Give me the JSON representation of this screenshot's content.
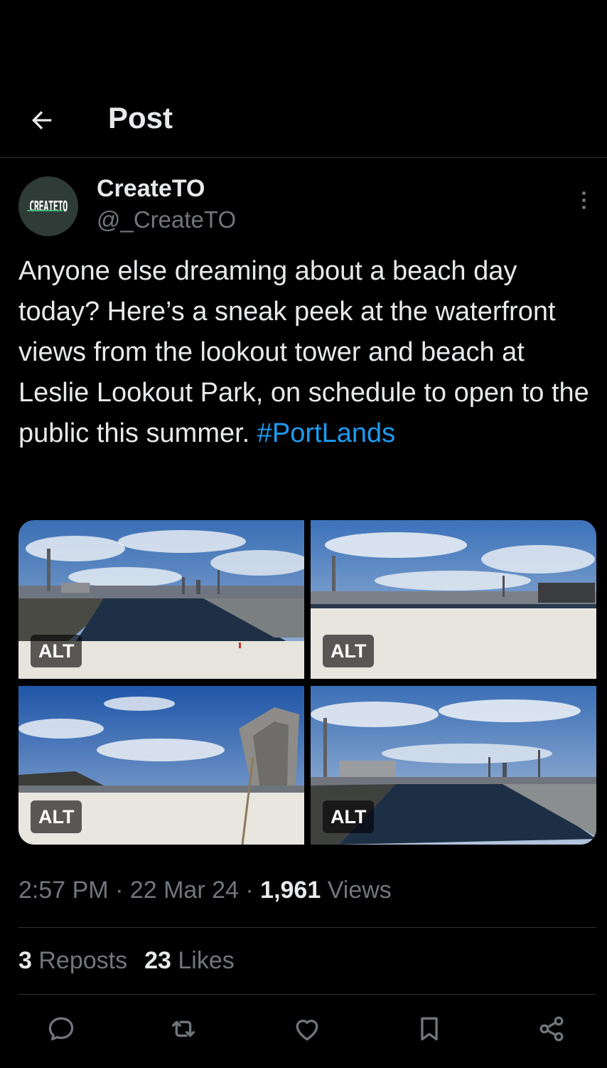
{
  "header": {
    "title": "Post",
    "back_icon": "arrow-left-icon"
  },
  "author": {
    "display_name": "CreateTO",
    "handle": "@_CreateTO",
    "avatar_text_create": "CREATE",
    "avatar_text_to": "TO",
    "more_icon": "more-vertical-icon"
  },
  "post": {
    "text": "Anyone else dreaming about a beach day today? Here’s a sneak peek at the waterfront views from the lookout tower and beach at Leslie Lookout Park, on schedule to open to the public this summer.",
    "hashtag": "#PortLands"
  },
  "media": [
    {
      "alt_label": "ALT"
    },
    {
      "alt_label": "ALT"
    },
    {
      "alt_label": "ALT"
    },
    {
      "alt_label": "ALT"
    }
  ],
  "meta": {
    "time": "2:57 PM",
    "sep1": " · ",
    "date": "22 Mar 24",
    "sep2": " · ",
    "views_count": "1,961",
    "views_label": " Views"
  },
  "stats": {
    "reposts_count": "3",
    "reposts_label": " Reposts",
    "likes_count": "23",
    "likes_label": " Likes"
  },
  "actions": {
    "reply_icon": "reply-icon",
    "repost_icon": "repost-icon",
    "like_icon": "heart-icon",
    "bookmark_icon": "bookmark-icon",
    "share_icon": "share-icon"
  },
  "colors": {
    "background": "#000000",
    "text": "#e7e9ea",
    "muted": "#71767b",
    "link": "#1d9bf0",
    "divider": "#2f3336"
  }
}
